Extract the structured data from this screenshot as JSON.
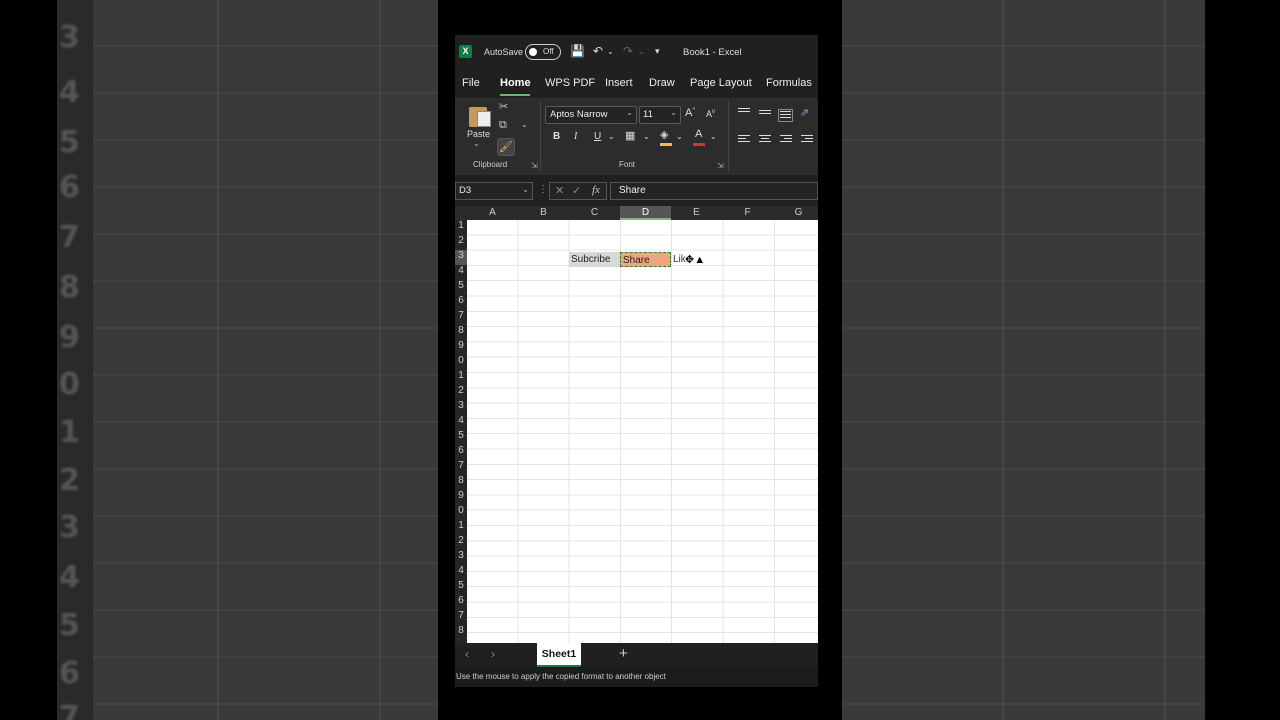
{
  "background": {
    "row_numbers": [
      "3",
      "4",
      "5",
      "6",
      "7",
      "8",
      "9",
      "0",
      "1",
      "2",
      "3",
      "4",
      "5",
      "6",
      "7"
    ]
  },
  "titlebar": {
    "autosave_label": "AutoSave",
    "autosave_state": "Off",
    "document_title": "Book1  -  Excel",
    "app_icon": "excel-logo"
  },
  "tabs": [
    "File",
    "Home",
    "WPS PDF",
    "Insert",
    "Draw",
    "Page Layout",
    "Formulas"
  ],
  "active_tab": "Home",
  "ribbon": {
    "clipboard": {
      "paste_label": "Paste",
      "group_label": "Clipboard"
    },
    "font": {
      "font_name": "Aptos Narrow",
      "font_size": "11",
      "bold": "B",
      "italic": "I",
      "underline": "U",
      "group_label": "Font",
      "fill_color": "#f0c040",
      "font_color": "#e03030"
    }
  },
  "formula_bar": {
    "name_box": "D3",
    "fx_label": "fx",
    "content": "Share"
  },
  "columns": [
    "A",
    "B",
    "C",
    "D",
    "E",
    "F",
    "G"
  ],
  "selected_column": "D",
  "rows": [
    "1",
    "2",
    "3",
    "4",
    "5",
    "6",
    "7",
    "8",
    "9",
    "0",
    "1",
    "2",
    "3",
    "4",
    "5",
    "6",
    "7",
    "8",
    "9",
    "0",
    "1",
    "2",
    "3",
    "4",
    "5",
    "6",
    "7",
    "8"
  ],
  "cells": {
    "C3": "Subcribe",
    "D3": "Share",
    "E3": "Like"
  },
  "colors": {
    "accent": "#107c41",
    "selected_cell_fill": "#efa67f",
    "subscribe_cell_fill": "#d8d8d8"
  },
  "sheets": {
    "active": "Sheet1",
    "add_label": "+"
  },
  "status_bar": {
    "message": "Use the mouse to apply the copied format to another object"
  }
}
